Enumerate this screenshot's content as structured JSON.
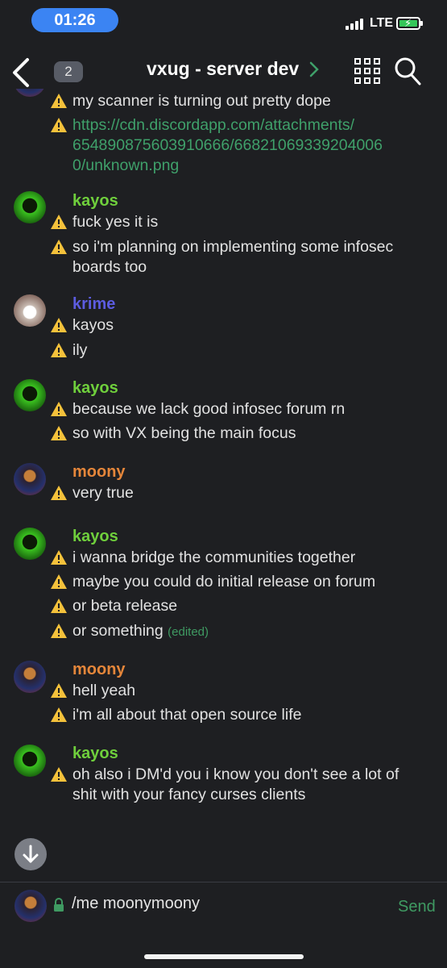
{
  "status_bar": {
    "time": "01:26",
    "network": "LTE"
  },
  "header": {
    "unread_count": "2",
    "channel_title": "vxug - server dev"
  },
  "colors": {
    "kayos": "#6fcf3c",
    "krime": "#5c5ce0",
    "moony": "#e5863a",
    "link": "#3fa06a",
    "warn": "#f4c13b"
  },
  "messages": {
    "g0": {
      "lines": [
        "my scanner is turning out pretty dope",
        "https://cdn.discordapp.com/attachments/",
        "654890875603910666/66821069339204006",
        "0/unknown.png"
      ]
    },
    "g1": {
      "author": "kayos",
      "lines": [
        "fuck yes it is",
        "so i'm planning on implementing some infosec",
        "boards too"
      ]
    },
    "g2": {
      "author": "krime",
      "lines": [
        "kayos",
        "ily"
      ]
    },
    "g3": {
      "author": "kayos",
      "lines": [
        "because we lack good infosec forum rn",
        "so with VX being the main focus"
      ]
    },
    "g4": {
      "author": "moony",
      "lines": [
        "very true"
      ]
    },
    "g5": {
      "author": "kayos",
      "lines": [
        "i wanna bridge the communities together",
        "maybe you could do initial release on forum",
        "or beta release",
        "or something"
      ],
      "edited": "(edited)"
    },
    "g6": {
      "author": "moony",
      "lines": [
        "hell yeah",
        "i'm all about that open source life"
      ]
    },
    "g7": {
      "author": "kayos",
      "lines": [
        "oh also i DM'd you i know you don't see a lot of",
        "shit with your fancy curses clients"
      ]
    }
  },
  "composer": {
    "text": "/me moonymoony",
    "send_label": "Send"
  }
}
